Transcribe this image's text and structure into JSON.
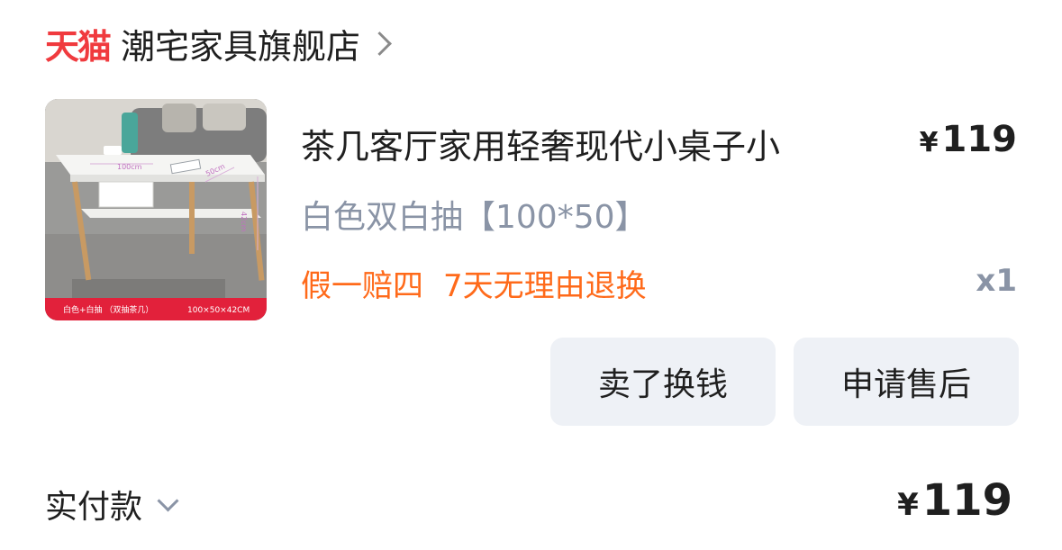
{
  "store": {
    "logo_text": "天猫",
    "name": "潮宅家具旗舰店"
  },
  "product": {
    "title": "茶几客厅家用轻奢现代小桌子小",
    "currency": "¥",
    "price": "119",
    "spec": "白色双白抽【100*50】",
    "tags": [
      "假一赔四",
      "7天无理由退换"
    ],
    "quantity": "x1",
    "image": {
      "dim_width": "100cm",
      "dim_depth": "50cm",
      "dim_height": "42cm",
      "banner_left": "白色+白抽 （双抽茶几）",
      "banner_right": "100×50×42CM"
    }
  },
  "actions": {
    "sell_label": "卖了换钱",
    "after_sale_label": "申请售后"
  },
  "summary": {
    "paid_label": "实付款",
    "currency": "¥",
    "total": "119"
  }
}
